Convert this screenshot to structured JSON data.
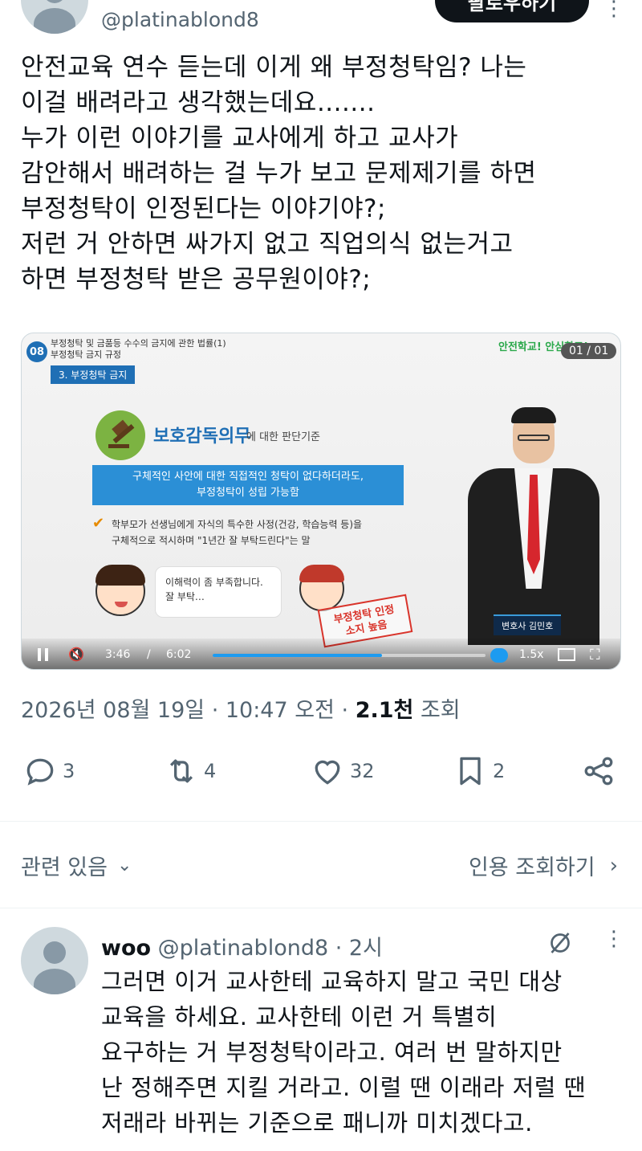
{
  "top": {
    "handle": "@platinablond8",
    "follow_label": "팔로우하기",
    "more_label": "⋮"
  },
  "tweet": {
    "text": "안전교육 연수 듣는데 이게 왜 부정청탁임? 나는\n이걸 배려라고 생각했는데요.......\n누가 이런 이야기를 교사에게 하고 교사가\n감안해서 배려하는 걸 누가 보고 문제제기를 하면\n부정청탁이 인정된다는 이야기야?;\n저런 거 안하면 싸가지 없고 직업의식 없는거고\n하면 부정청탁 받은 공무원이야?;"
  },
  "video": {
    "badge": "08",
    "header": "부정청탁 및 금품등 수수의 금지에 관한 법률(1)\n부정청탁 금지 규정",
    "section": "3. 부정청탁 금지",
    "brand": "안전학교! 안심학교!",
    "page": "01 / 01",
    "criteria_big": "보호감독의무",
    "criteria_small": "에 대한 판단기준",
    "bluebox": "구체적인 사안에 대한 직접적인 청탁이 없다하더라도,\n부정청탁이 성립 가능함",
    "check": "✔",
    "point": "학부모가 선생님에게 자식의 특수한 사정(건강, 학습능력 등)을\n구체적으로 적시하며 \"1년간 잘 부탁드린다\"는 말",
    "bubble": "이해력이 좀 부족합니다.\n잘 부탁…",
    "stamp": "부정청탁 인정\n소지 높음",
    "speaker_name": "변호사 김민호",
    "time_current": "3:46",
    "time_sep": "/",
    "time_total": "6:02",
    "progress": 0.62,
    "speed": "1.5x"
  },
  "timestamp": {
    "date": "2026년 08월 19일 · 10:47 오전 · ",
    "views": "2.1천",
    "views_label": " 조회"
  },
  "actions": {
    "replies": "3",
    "retweets": "4",
    "likes": "32",
    "bookmarks": "2"
  },
  "related": {
    "label": "관련 있음",
    "chevron": "⌄",
    "quotes_label": "인용 조회하기",
    "quotes_chevron": "›"
  },
  "reply": {
    "name": "woo",
    "handle": " @platinablond8 · 2시",
    "more": "⋮",
    "text": "그러면 이거 교사한테 교육하지 말고 국민 대상\n교육을 하세요. 교사한테 이런 거 특별히\n요구하는 거 부정청탁이라고. 여러 번 말하지만\n난 정해주면 지킬 거라고. 이럴 땐 이래라 저럴 땐\n저래라 바뀌는 기준으로 패니까 미치겠다고."
  },
  "colors": {
    "text": "#0f1419",
    "secondary": "#536471",
    "accent": "#1d9bf0"
  }
}
